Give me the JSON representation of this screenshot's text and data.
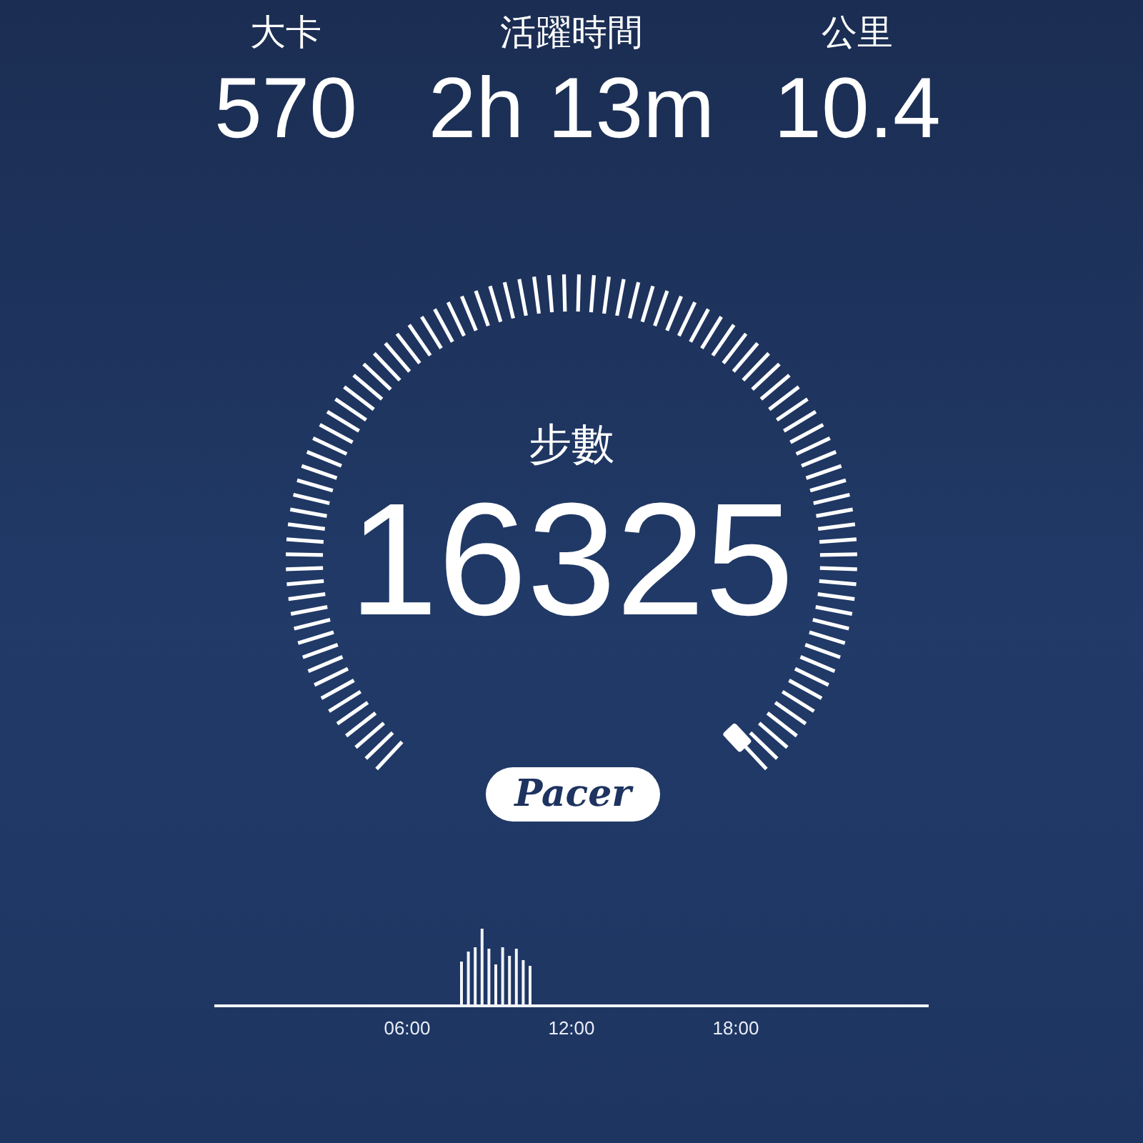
{
  "stats": [
    {
      "label": "大卡",
      "value": "570"
    },
    {
      "label": "活躍時間",
      "value": "2h 13m"
    },
    {
      "label": "公里",
      "value": "10.4"
    }
  ],
  "gauge": {
    "label": "步數",
    "value": "16325"
  },
  "logo": "Pacer",
  "activity": {
    "time_labels": [
      "06:00",
      "12:00",
      "18:00"
    ]
  }
}
